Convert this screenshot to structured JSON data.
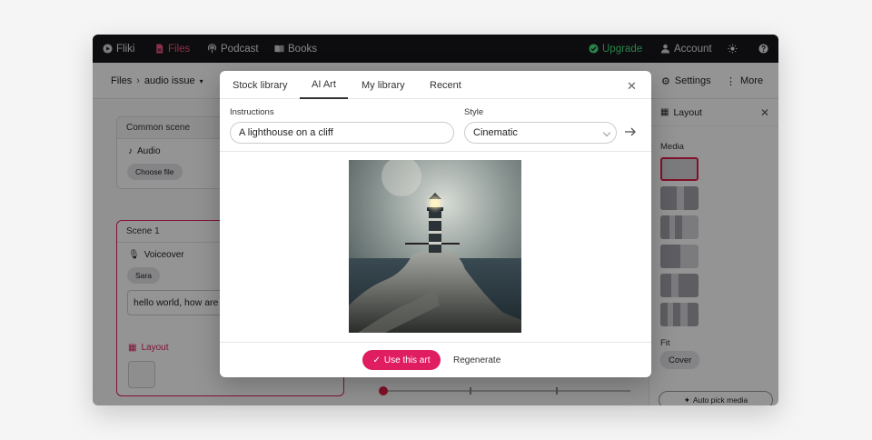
{
  "topbar": {
    "brand": "Fliki",
    "files": "Files",
    "podcast": "Podcast",
    "books": "Books",
    "upgrade": "Upgrade",
    "account": "Account",
    "icons": [
      "play-icon",
      "file-icon",
      "podcast-icon",
      "book-icon",
      "check-circle-icon",
      "user-icon",
      "sun-icon",
      "help-icon"
    ]
  },
  "toolbar": {
    "breadcrumb_root": "Files",
    "breadcrumb_current": "audio issue",
    "settings": "Settings",
    "more": "More"
  },
  "common_scene": {
    "title": "Common scene",
    "audio_label": "Audio",
    "choose_file": "Choose file"
  },
  "scene1": {
    "title": "Scene 1",
    "voiceover_label": "Voiceover",
    "voice": "Sara",
    "text": "hello world, how are",
    "layout_label": "Layout"
  },
  "right_panel": {
    "title": "Layout",
    "media_label": "Media",
    "fit_label": "Fit",
    "fit_value": "Cover",
    "auto_pick": "Auto pick media"
  },
  "modal": {
    "tabs": [
      "Stock library",
      "AI Art",
      "My library",
      "Recent"
    ],
    "active_tab": "AI Art",
    "instructions_label": "Instructions",
    "instructions_value": "A lighthouse on a cliff",
    "style_label": "Style",
    "style_value": "Cinematic",
    "use_button": "Use this art",
    "regenerate_button": "Regenerate"
  },
  "colors": {
    "accent": "#e11d62",
    "topbar_bg": "#18181b",
    "upgrade_green": "#4ade80"
  }
}
